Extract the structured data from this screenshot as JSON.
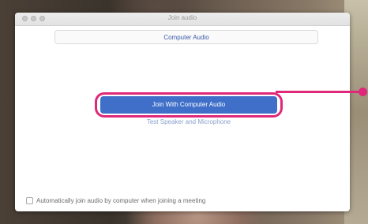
{
  "window": {
    "title": "Join audio"
  },
  "tabs": [
    {
      "label": "Computer Audio"
    }
  ],
  "main": {
    "join_button": "Join With Computer Audio",
    "test_link": "Test Speaker and Microphone"
  },
  "footer": {
    "auto_join_label": "Automatically join audio by computer when joining a meeting",
    "auto_join_checked": false
  },
  "colors": {
    "accent": "#3f6fc9",
    "highlight": "#e0287a",
    "link": "#8aa0cc"
  }
}
